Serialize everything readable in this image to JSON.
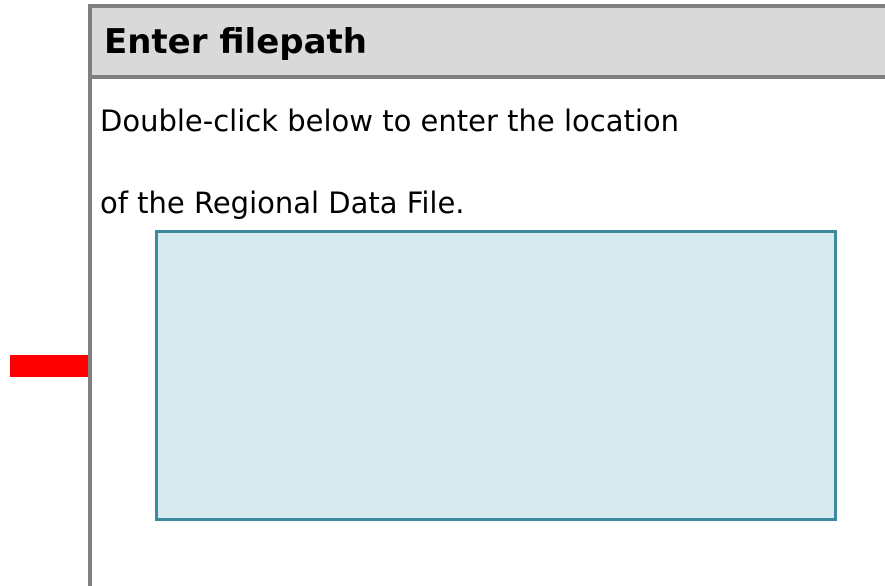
{
  "panel": {
    "title": "Enter filepath",
    "instruction_line_1": "Double-click below to enter the location",
    "instruction_line_2": "of the Regional Data File.",
    "filepath_value": ""
  },
  "icons": {
    "pointer": "arrow-right-icon"
  },
  "colors": {
    "header_background": "#d9d9d9",
    "border": "#7f7f7f",
    "input_background": "#d6eaf0",
    "input_border": "#3d8aa0",
    "arrow": "#ff0000"
  }
}
